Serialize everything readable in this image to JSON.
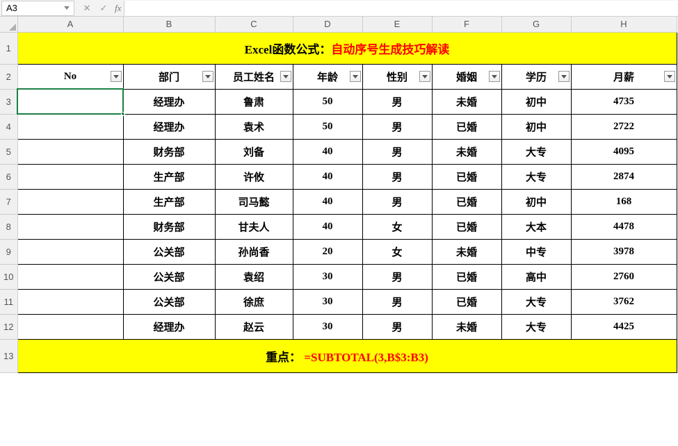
{
  "namebox": {
    "ref": "A3"
  },
  "formula_bar": {
    "fx_label": "fx",
    "value": "",
    "cancel": "✕",
    "confirm": "✓"
  },
  "col_letters": [
    "A",
    "B",
    "C",
    "D",
    "E",
    "F",
    "G",
    "H"
  ],
  "row_numbers": [
    "1",
    "2",
    "3",
    "4",
    "5",
    "6",
    "7",
    "8",
    "9",
    "10",
    "11",
    "12",
    "13"
  ],
  "title": {
    "black": "Excel函数公式：",
    "red": "自动序号生成技巧解读"
  },
  "headers": [
    "No",
    "部门",
    "员工姓名",
    "年龄",
    "性别",
    "婚姻",
    "学历",
    "月薪"
  ],
  "rows": [
    {
      "no": "",
      "dept": "经理办",
      "name": "鲁肃",
      "age": "50",
      "sex": "男",
      "marry": "未婚",
      "edu": "初中",
      "salary": "4735"
    },
    {
      "no": "",
      "dept": "经理办",
      "name": "袁术",
      "age": "50",
      "sex": "男",
      "marry": "已婚",
      "edu": "初中",
      "salary": "2722"
    },
    {
      "no": "",
      "dept": "财务部",
      "name": "刘备",
      "age": "40",
      "sex": "男",
      "marry": "未婚",
      "edu": "大专",
      "salary": "4095"
    },
    {
      "no": "",
      "dept": "生产部",
      "name": "许攸",
      "age": "40",
      "sex": "男",
      "marry": "已婚",
      "edu": "大专",
      "salary": "2874"
    },
    {
      "no": "",
      "dept": "生产部",
      "name": "司马懿",
      "age": "40",
      "sex": "男",
      "marry": "已婚",
      "edu": "初中",
      "salary": "168"
    },
    {
      "no": "",
      "dept": "财务部",
      "name": "甘夫人",
      "age": "40",
      "sex": "女",
      "marry": "已婚",
      "edu": "大本",
      "salary": "4478"
    },
    {
      "no": "",
      "dept": "公关部",
      "name": "孙尚香",
      "age": "20",
      "sex": "女",
      "marry": "未婚",
      "edu": "中专",
      "salary": "3978"
    },
    {
      "no": "",
      "dept": "公关部",
      "name": "袁绍",
      "age": "30",
      "sex": "男",
      "marry": "已婚",
      "edu": "高中",
      "salary": "2760"
    },
    {
      "no": "",
      "dept": "公关部",
      "name": "徐庶",
      "age": "30",
      "sex": "男",
      "marry": "已婚",
      "edu": "大专",
      "salary": "3762"
    },
    {
      "no": "",
      "dept": "经理办",
      "name": "赵云",
      "age": "30",
      "sex": "男",
      "marry": "未婚",
      "edu": "大专",
      "salary": "4425"
    }
  ],
  "footer": {
    "black": "重点： ",
    "red": "=SUBTOTAL(3,B$3:B3)"
  }
}
